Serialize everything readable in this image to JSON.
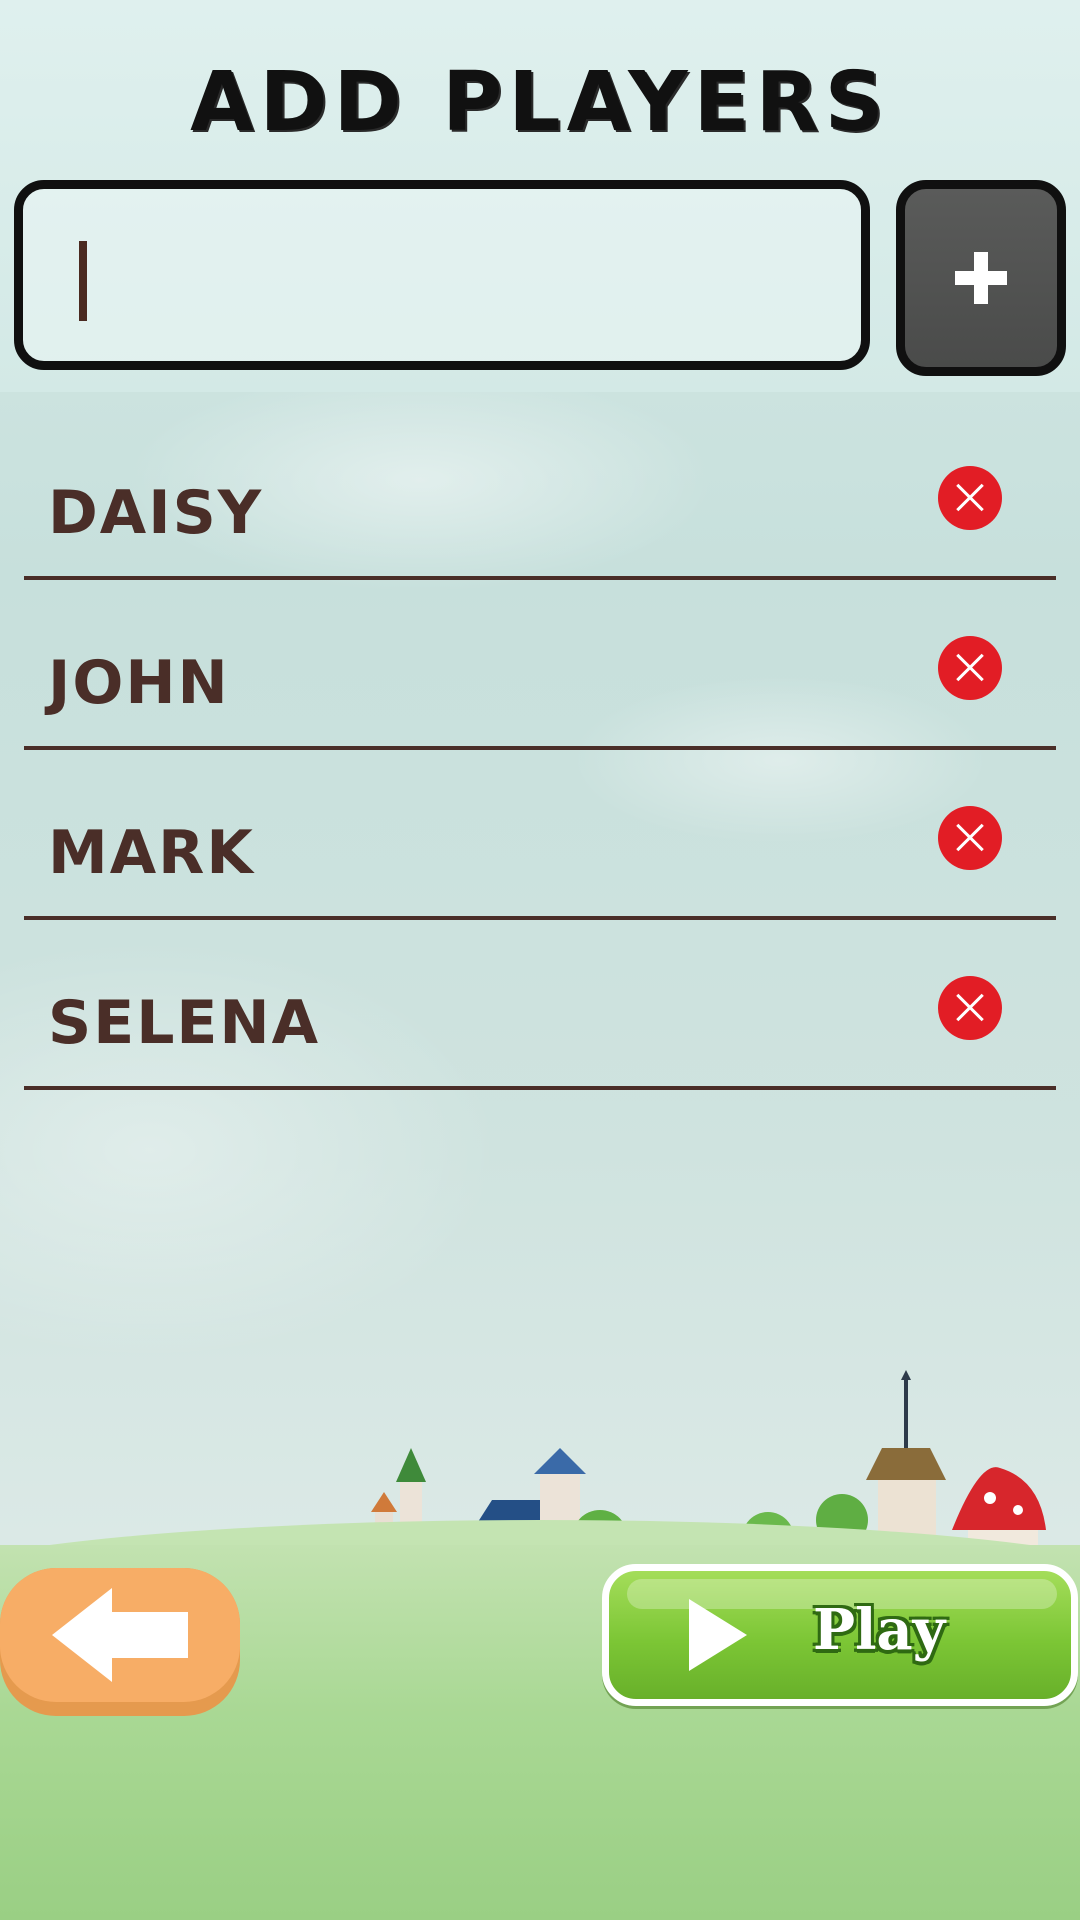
{
  "header": {
    "title": "ADD PLAYERS"
  },
  "name_input": {
    "value": "",
    "placeholder": ""
  },
  "add_button": {
    "icon": "plus-icon",
    "label": "+"
  },
  "players": [
    {
      "name": "DAISY"
    },
    {
      "name": "JOHN"
    },
    {
      "name": "MARK"
    },
    {
      "name": "SELENA"
    }
  ],
  "footer": {
    "back_icon": "arrow-left-icon",
    "play_label": "Play",
    "play_icon": "play-triangle-icon"
  },
  "colors": {
    "title": "#111111",
    "player_name": "#4a2e28",
    "remove": "#e21d25",
    "add_button": "#4a4b4a",
    "back_button": "#f7ad66",
    "play_button": "#7cc635"
  }
}
